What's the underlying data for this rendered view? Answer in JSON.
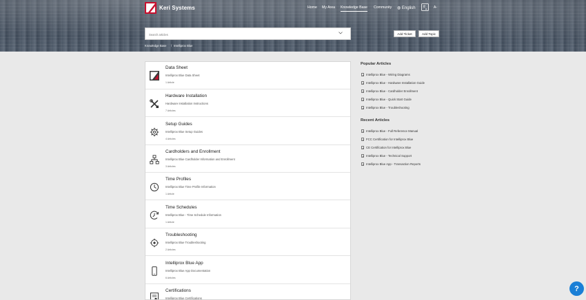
{
  "header": {
    "brand": "Keri Systems",
    "nav": [
      {
        "label": "Home"
      },
      {
        "label": "My Area"
      },
      {
        "label": "Knowledge Base"
      },
      {
        "label": "Community"
      }
    ],
    "language": "English",
    "az_label": "A-"
  },
  "search": {
    "placeholder": "Search articles"
  },
  "buttons": {
    "add_ticket": "Add Ticket",
    "add_topic": "Add Topic"
  },
  "breadcrumb": {
    "root": "Knowledge Base",
    "sep": "/",
    "current": "Intelliprox Blue"
  },
  "categories": [
    {
      "title": "Data Sheet",
      "desc": "Intelliprox Blue Data Sheet",
      "count": "1 Article",
      "icon": "logo-icon"
    },
    {
      "title": "Hardware Installation",
      "desc": "Hardware Installation Instructions",
      "count": "7 Articles",
      "icon": "tools-icon"
    },
    {
      "title": "Setup Guides",
      "desc": "Intelliprox Blue Setup Guides",
      "count": "4 Articles",
      "icon": "gear-icon"
    },
    {
      "title": "Cardholders and Enrollment",
      "desc": "Intelliprox Blue Cardholder Information and Enrollment",
      "count": "3 Articles",
      "icon": "network-icon"
    },
    {
      "title": "Time Profiles",
      "desc": "Intelliprox Blue Time Profile Information",
      "count": "1 Article",
      "icon": "clock-icon"
    },
    {
      "title": "Time Schedules",
      "desc": "Intelliprox Blue - Time Schedule Information",
      "count": "1 Article",
      "icon": "schedule-icon"
    },
    {
      "title": "Troubleshooting",
      "desc": "Intelliprox Blue Troubleshooting",
      "count": "2 Articles",
      "icon": "troubleshoot-icon"
    },
    {
      "title": "Intelliprox Blue App",
      "desc": "Intelliprox Blue App Documentation",
      "count": "6 Articles",
      "icon": "phone-icon"
    },
    {
      "title": "Certifications",
      "desc": "Intelliprox Blue Certifications",
      "count": "",
      "icon": "certificate-icon"
    }
  ],
  "popular": {
    "title": "Popular Articles",
    "items": [
      "Intelliprox Blue - Wiring Diagrams",
      "Intelliprox Blue - Hardware Installation Guide",
      "Intelliprox Blue - Cardholder Enrollment",
      "Intelliprox Blue - Quick Start Guide",
      "Intelliprox Blue - Troubleshooting"
    ]
  },
  "recent": {
    "title": "Recent Articles",
    "items": [
      "Intelliprox Blue - Full Reference Manual",
      "FCC Certification for Intelliprox Blue",
      "CE Certification for Intelliprox Blue",
      "Intelliprox Blue - Technical Support",
      "Intelliprox Blue App - Transaction Reports"
    ]
  },
  "help": {
    "label": "?"
  }
}
